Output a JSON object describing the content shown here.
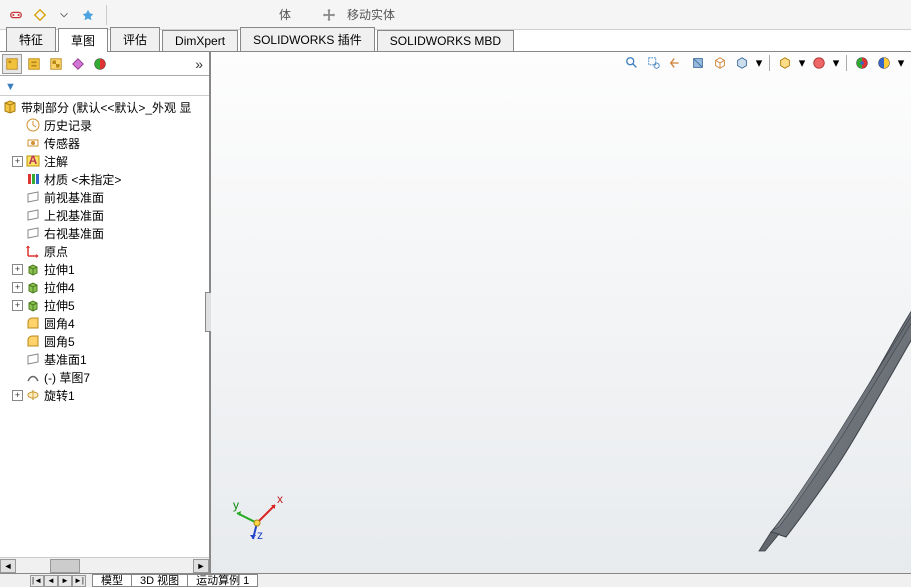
{
  "top_toolbar": {
    "move_solid_label": "移动实体"
  },
  "cmd_tabs": [
    "特征",
    "草图",
    "评估",
    "DimXpert",
    "SOLIDWORKS 插件",
    "SOLIDWORKS MBD"
  ],
  "cmd_tabs_active": 1,
  "tree": {
    "root": "带刺部分  (默认<<默认>_外观 显",
    "items": [
      {
        "icon": "history",
        "label": "历史记录"
      },
      {
        "icon": "sensor",
        "label": "传感器"
      },
      {
        "icon": "annotation",
        "label": "注解",
        "exp": "+"
      },
      {
        "icon": "material",
        "label": "材质 <未指定>"
      },
      {
        "icon": "plane",
        "label": "前视基准面"
      },
      {
        "icon": "plane",
        "label": "上视基准面"
      },
      {
        "icon": "plane",
        "label": "右视基准面"
      },
      {
        "icon": "origin",
        "label": "原点"
      },
      {
        "icon": "extrude",
        "label": "拉伸1",
        "exp": "+"
      },
      {
        "icon": "extrude",
        "label": "拉伸4",
        "exp": "+"
      },
      {
        "icon": "extrude",
        "label": "拉伸5",
        "exp": "+"
      },
      {
        "icon": "fillet",
        "label": "圆角4"
      },
      {
        "icon": "fillet",
        "label": "圆角5"
      },
      {
        "icon": "plane",
        "label": "基准面1"
      },
      {
        "icon": "sketch",
        "label": "(-) 草图7"
      },
      {
        "icon": "revolve",
        "label": "旋转1",
        "exp": "+"
      }
    ]
  },
  "bottom_tabs": [
    "模型",
    "3D 视图",
    "运动算例 1"
  ],
  "view_icons": [
    "zoom",
    "zoom-area",
    "rotate",
    "pan",
    "section",
    "display-style",
    "dd",
    "view-orient",
    "dd",
    "hide-show",
    "dd",
    "appearance",
    "scene",
    "dd"
  ],
  "triad_labels": {
    "x": "x",
    "y": "y",
    "z": "z"
  },
  "filter_placeholder": ""
}
